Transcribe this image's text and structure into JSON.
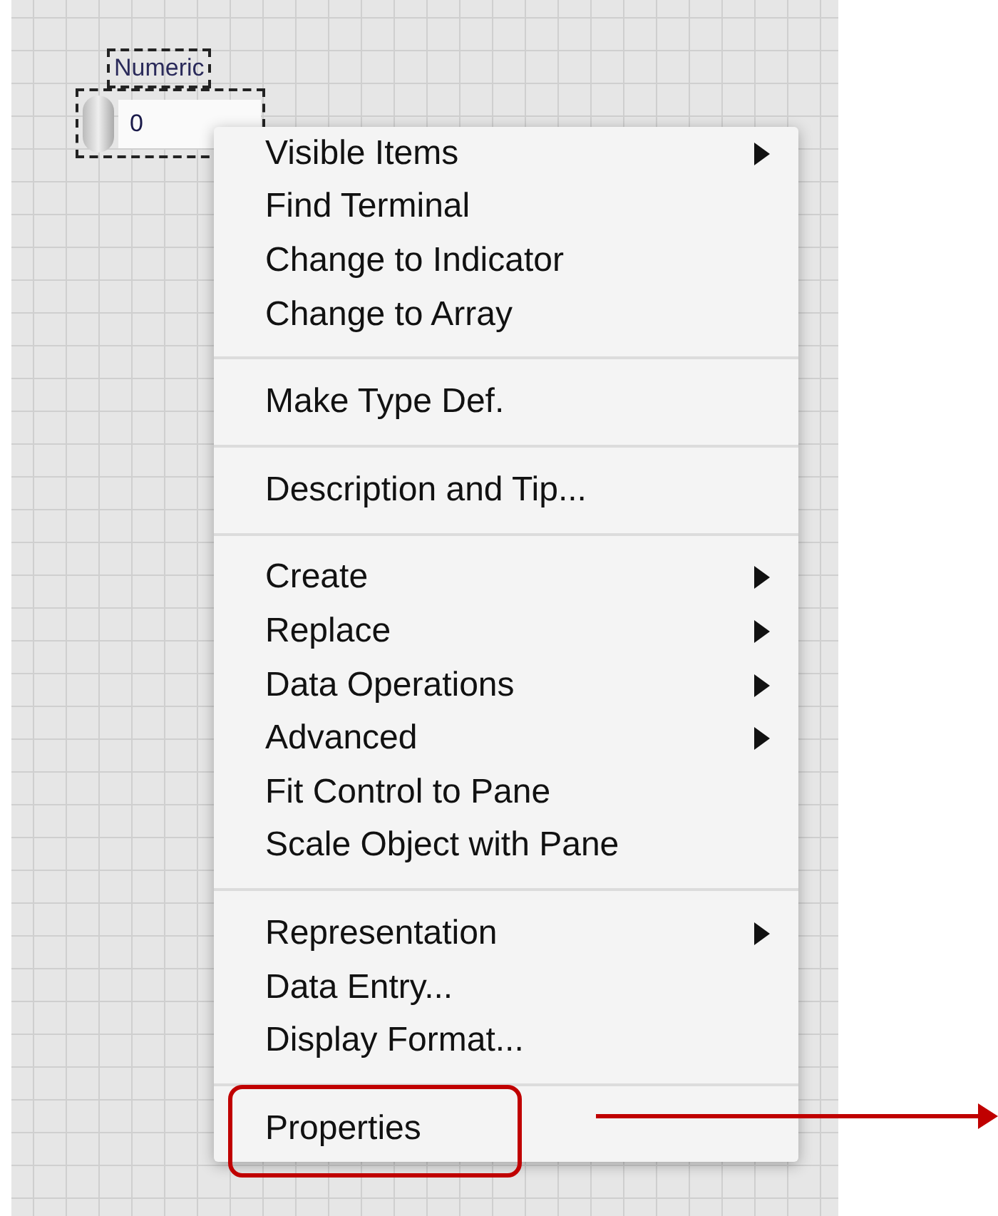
{
  "numeric_control": {
    "label": "Numeric",
    "value": "0"
  },
  "context_menu": {
    "groups": [
      {
        "items": [
          {
            "label": "Visible Items",
            "submenu": true,
            "annotated": false
          },
          {
            "label": "Find Terminal",
            "submenu": false,
            "annotated": false
          },
          {
            "label": "Change to Indicator",
            "submenu": false,
            "annotated": false
          },
          {
            "label": "Change to Array",
            "submenu": false,
            "annotated": false
          }
        ]
      },
      {
        "items": [
          {
            "label": "Make Type Def.",
            "submenu": false,
            "annotated": false
          }
        ]
      },
      {
        "items": [
          {
            "label": "Description and Tip...",
            "submenu": false,
            "annotated": false
          }
        ]
      },
      {
        "items": [
          {
            "label": "Create",
            "submenu": true,
            "annotated": false
          },
          {
            "label": "Replace",
            "submenu": true,
            "annotated": false
          },
          {
            "label": "Data Operations",
            "submenu": true,
            "annotated": false
          },
          {
            "label": "Advanced",
            "submenu": true,
            "annotated": false
          },
          {
            "label": "Fit Control to Pane",
            "submenu": false,
            "annotated": false
          },
          {
            "label": "Scale Object with Pane",
            "submenu": false,
            "annotated": false
          }
        ]
      },
      {
        "items": [
          {
            "label": "Representation",
            "submenu": true,
            "annotated": false
          },
          {
            "label": "Data Entry...",
            "submenu": false,
            "annotated": false
          },
          {
            "label": "Display Format...",
            "submenu": false,
            "annotated": false
          }
        ]
      },
      {
        "items": [
          {
            "label": "Properties",
            "submenu": false,
            "annotated": true
          }
        ]
      }
    ]
  }
}
